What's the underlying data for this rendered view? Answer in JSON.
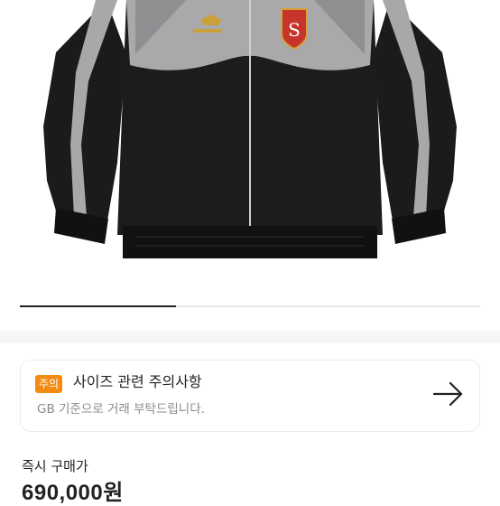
{
  "product": {
    "image_alt": "",
    "carousel_progress": 0.34
  },
  "notice": {
    "badge": "주의",
    "title": "사이즈 관련 주의사항",
    "description": "GB 기준으로 거래 부탁드립니다.",
    "arrow_icon": "arrow-right-icon",
    "badge_color": "#F28B12"
  },
  "purchase": {
    "label": "즉시 구매가",
    "price": "690,000원"
  }
}
